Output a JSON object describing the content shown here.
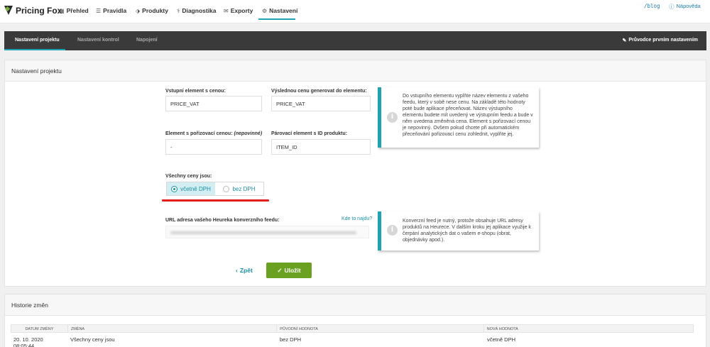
{
  "app": {
    "logo_text": "Pricing Fox"
  },
  "topnav": {
    "items": [
      {
        "label": "Přehled",
        "icon": "chart-icon"
      },
      {
        "label": "Pravidla",
        "icon": "list-icon"
      },
      {
        "label": "Produkty",
        "icon": "tags-icon"
      },
      {
        "label": "Diagnostika",
        "icon": "stethoscope-icon"
      },
      {
        "label": "Exporty",
        "icon": "envelope-icon"
      },
      {
        "label": "Nastavení",
        "icon": "gear-icon",
        "active": true
      }
    ],
    "blog_link": "/blog",
    "help_link": "Nápověda"
  },
  "tabs": {
    "items": [
      {
        "label": "Nastavení projektu",
        "active": true
      },
      {
        "label": "Nastavení kontrol"
      },
      {
        "label": "Napojení"
      }
    ],
    "wizard_label": "Průvodce prvním nastavením"
  },
  "project": {
    "title": "Nastavení projektu",
    "input_element_label": "Vstupní element s cenou:",
    "input_element_value": "PRICE_VAT",
    "output_element_label": "Výslednou cenu generovat do elementu:",
    "output_element_value": "PRICE_VAT",
    "purchase_price_label": "Element s pořizovací cenou:",
    "purchase_price_optional": "(nepovinné)",
    "purchase_price_value": "-",
    "pairing_label": "Párovací element s ID produktu:",
    "pairing_value": "ITEM_ID",
    "info1": "Do vstupního elementu vyplňte název elementu z vašeho feedu, který v sobě nese cenu. Na základě této hodnoty poté bude aplikace přeceňovat. Název výstupního elementu budete mít uvedený ve výstupním feedu a bude v něm uvedena změněná cena. Element s pořizovací cenou je nepovinný. Ovšem pokud chcete při automatickém přeceňování pořizovací cenu zohlednit, vyplňte jej.",
    "vat_label": "Všechny ceny jsou:",
    "vat_options": [
      "včetně DPH",
      "bez DPH"
    ],
    "vat_selected": "včetně DPH",
    "heureka_label": "URL adresa vašeho Heureka konverzního feedu:",
    "heureka_help_link": "Kde to najdu?",
    "info2": "Konverzní feed je nutný, protože obsahuje URL adresy produktů na Heurece. V dalším kroku jej aplikace využije k čerpání analytických dat o vašem e-shopu (obrat, objednávky apod.).",
    "back_label": "Zpět",
    "save_label": "Uložit"
  },
  "history": {
    "title": "Historie změn",
    "columns": [
      "Datum změny",
      "Změna",
      "Původní hodnota",
      "Nová hodnota"
    ],
    "rows": [
      [
        "20. 10. 2020 08:05:44",
        "Všechny ceny jsou",
        "bez DPH",
        "včetně DPH"
      ]
    ]
  },
  "colors": {
    "accent": "#1fa3b3",
    "save_green": "#6aa121",
    "dark_bar": "#3a3a3a",
    "highlight_red": "#e31c1c"
  }
}
